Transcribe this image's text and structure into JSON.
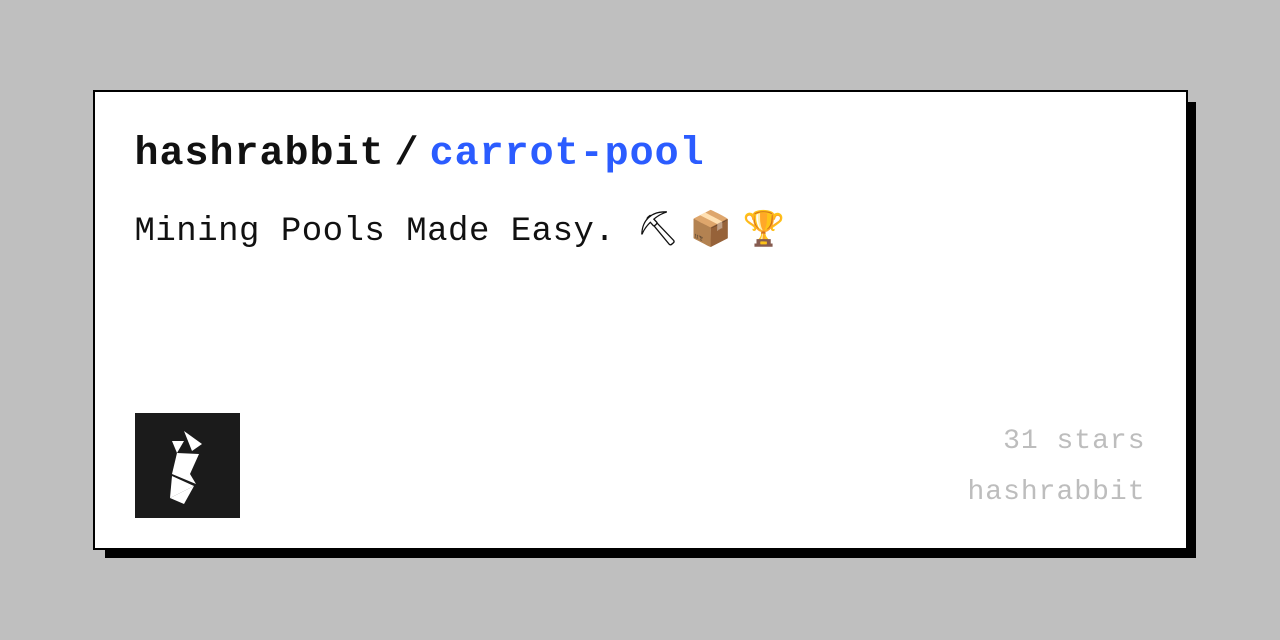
{
  "title": {
    "owner": "hashrabbit",
    "separator": "/",
    "repo": "carrot-pool"
  },
  "description_text": "Mining Pools Made Easy.",
  "description_emojis": "⛏ 📦 🏆",
  "meta": {
    "stars": "31 stars",
    "author": "hashrabbit"
  }
}
